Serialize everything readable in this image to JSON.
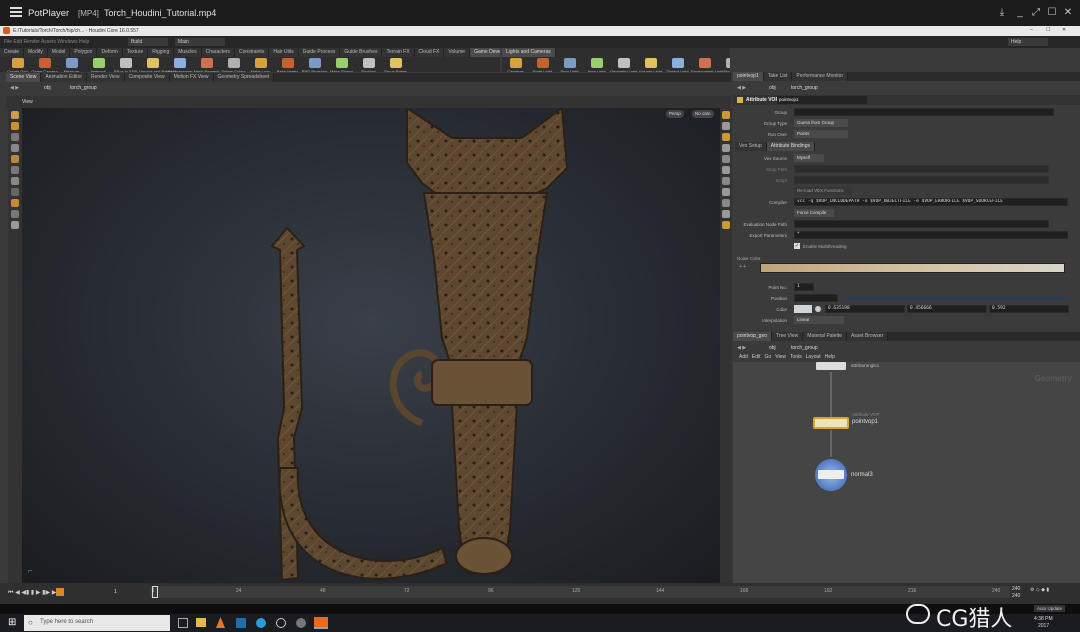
{
  "player": {
    "app_name": "PotPlayer",
    "format": "[MP4]",
    "file_name": "Torch_Houdini_Tutorial.mp4"
  },
  "houdini": {
    "window_path": "E:/Tutorials/Torch/Torch/hip/ch... - Houdini Core 16.0.557",
    "desktop": "Build",
    "desktop_alt": "Main",
    "help_button": "Help",
    "shelf_tabs": [
      "Create",
      "Modify",
      "Model",
      "Polygon",
      "Deform",
      "Texture",
      "Rigging",
      "Muscles",
      "Characters",
      "Constraints",
      "Hair Utils",
      "Guide Process",
      "Guide Brushes",
      "Terrain FX",
      "Cloud FX",
      "Volume",
      "Game Development Toolset"
    ],
    "shelf_tools": [
      "Create Geo",
      "Game Camera",
      "Measure",
      "Network",
      "BBox to SSP",
      "Unpack and Remesh",
      "UV Unwrapper",
      "Mesh Remesh",
      "Delete Colors",
      "Make Loop",
      "Bake Vertex",
      "RHD Projector",
      "Make Glossy",
      "Packing",
      "Group Bakes"
    ],
    "light_tabs": [
      "Lights and Cameras"
    ],
    "light_tools": [
      "Cameras",
      "Point Light",
      "Spot Light",
      "Area Light",
      "Geometry Light",
      "Volume Light",
      "Distant Light",
      "Environment Light",
      "Sky Light",
      "GI Light",
      "Caustic Light",
      "Portal Light",
      "Ambient Light",
      "Camera",
      "VR Camera",
      "Switcher"
    ],
    "pane_tabs_left": [
      "Scene View",
      "Animation Editor",
      "Render View",
      "Composite View",
      "Motion FX View",
      "Geometry Spreadsheet"
    ],
    "path_obj": "obj",
    "path_node": "torch_group",
    "view_label": "View",
    "persp_button": "Persp",
    "cam_button": "No cam"
  },
  "params": {
    "tabs": [
      "pointvop1",
      "Take List",
      "Performance Monitor"
    ],
    "path_obj": "obj",
    "path_node": "torch_group",
    "node_type": "Attribute VOP",
    "node_name": "pointvop1",
    "group_label": "Group",
    "group_value": "",
    "group_type_label": "Group Type",
    "group_type_value": "Guess from Group",
    "run_over_label": "Run Over",
    "run_over_value": "Points",
    "sub_tabs": [
      "Vex Setup",
      "Attribute Bindings"
    ],
    "vex_source_label": "Vex Source",
    "vex_source_value": "Myself",
    "shop_path_label": "Shop Path",
    "script_label": "Script",
    "reload_button": "Re-load VEX Functions",
    "compiler_label": "Compiler",
    "compiler_value": "vcc -q $VOP_INCLUDEPATH -o $VOP_OBJECTFILE -e $VOP_ERRORFILE $VOP_SOURCEFILE",
    "force_compile_button": "Force Compile",
    "eval_node_label": "Evaluation Node Path",
    "export_params_label": "Export Parameters",
    "export_params_value": "*",
    "multithread_label": "Enable Multithreading",
    "noise_color_label": "Noise Color",
    "point_no_label": "Point No.",
    "point_no_value": "1",
    "position_label": "Position",
    "color_label": "Color",
    "color_r": "0.635198",
    "color_g": "0.456666",
    "color_b": "0.592",
    "interp_label": "Interpolation",
    "interp_value": "Linear"
  },
  "network": {
    "tabs": [
      "pointvop_geo",
      "Tree View",
      "Material Palette",
      "Asset Browser"
    ],
    "path_obj": "obj",
    "path_node": "torch_group",
    "menu": [
      "Add",
      "Edit",
      "Go",
      "View",
      "Tools",
      "Layout",
      "Help"
    ],
    "context_label": "Geometry",
    "node_top_label": "attribwrangle1",
    "node_top_sub": "",
    "node_vop_type": "Attribute VOP",
    "node_vop_name": "pointvop1",
    "node_normal_name": "normal3"
  },
  "playbar": {
    "frame": "1",
    "start": "1",
    "ticks": [
      "1",
      "24",
      "48",
      "72",
      "96",
      "120",
      "144",
      "168",
      "192",
      "216",
      "240"
    ],
    "end_a": "240",
    "end_b": "240",
    "auto_update": "Auto Update"
  },
  "taskbar": {
    "search_placeholder": "Type here to search",
    "time": "4:38 PM",
    "date": "2017"
  },
  "watermark": "CG猎人"
}
